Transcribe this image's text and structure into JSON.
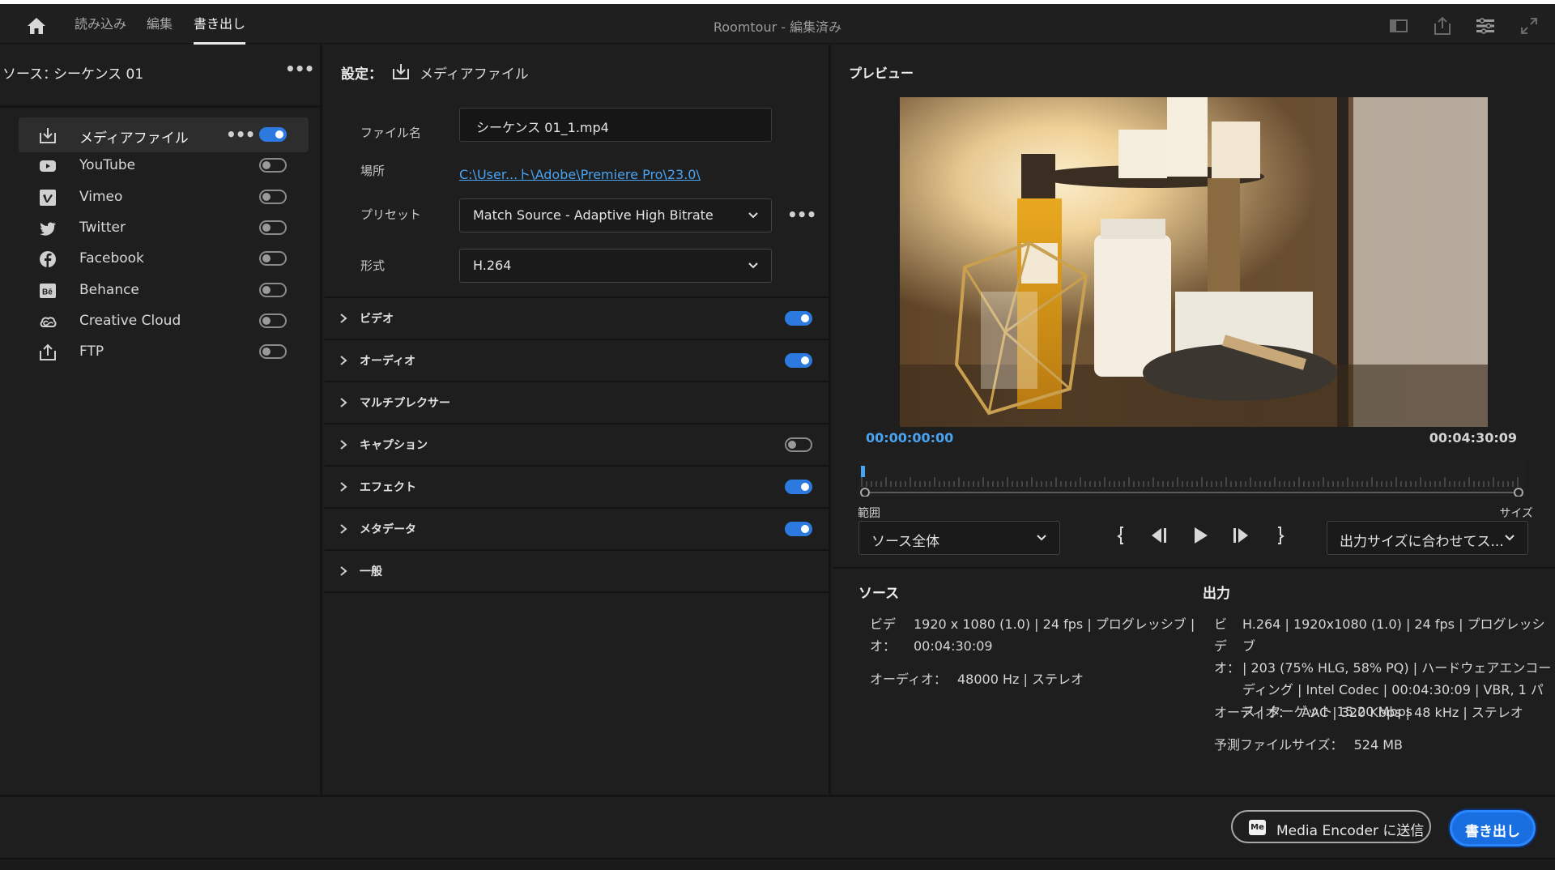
{
  "app": {
    "title": "Roomtour",
    "title_suffix": " - 編集済み"
  },
  "tabs": [
    {
      "label": "読み込み"
    },
    {
      "label": "編集"
    },
    {
      "label": "書き出し",
      "active": true
    }
  ],
  "source": {
    "label": "ソース：",
    "value": "シーケンス 01"
  },
  "destinations": [
    {
      "label": "メディアファイル",
      "icon": "media-file-export-icon",
      "enabled": true,
      "active": true
    },
    {
      "label": "YouTube",
      "icon": "youtube-icon",
      "enabled": false
    },
    {
      "label": "Vimeo",
      "icon": "vimeo-icon",
      "enabled": false
    },
    {
      "label": "Twitter",
      "icon": "twitter-icon",
      "enabled": false
    },
    {
      "label": "Facebook",
      "icon": "facebook-icon",
      "enabled": false
    },
    {
      "label": "Behance",
      "icon": "behance-icon",
      "enabled": false
    },
    {
      "label": "Creative Cloud",
      "icon": "creative-cloud-icon",
      "enabled": false
    },
    {
      "label": "FTP",
      "icon": "ftp-upload-icon",
      "enabled": false
    }
  ],
  "settings": {
    "label": "設定：",
    "target": "メディアファイル",
    "filename_label": "ファイル名",
    "filename": "シーケンス 01_1.mp4",
    "location_label": "場所",
    "location": "C:\\User...ト\\Adobe\\Premiere Pro\\23.0\\",
    "preset_label": "プリセット",
    "preset": "Match Source - Adaptive High Bitrate",
    "format_label": "形式",
    "format": "H.264",
    "sections": [
      {
        "name": "ビデオ",
        "toggle": true,
        "on": true
      },
      {
        "name": "オーディオ",
        "toggle": true,
        "on": true
      },
      {
        "name": "マルチプレクサー",
        "toggle": false
      },
      {
        "name": "キャプション",
        "toggle": true,
        "on": false
      },
      {
        "name": "エフェクト",
        "toggle": true,
        "on": true
      },
      {
        "name": "メタデータ",
        "toggle": true,
        "on": true
      },
      {
        "name": "一般",
        "toggle": false
      }
    ]
  },
  "preview": {
    "title": "プレビュー",
    "timecode_start": "00:00:00:00",
    "timecode_end": "00:04:30:09",
    "playhead_fraction": 0,
    "range_label": "範囲",
    "range_value": "ソース全体",
    "size_label": "サイズ",
    "size_value": "出力サイズに合わせてス..."
  },
  "info": {
    "source_title": "ソース",
    "source_video_key_1": "ビデ",
    "source_video_key_2": "オ：",
    "source_video_line_1": "1920 x 1080 (1.0) | 24 fps | プログレッシブ |",
    "source_video_line_2": "00:04:30:09",
    "source_audio_key": "オーディオ：",
    "source_audio": "48000 Hz | ステレオ",
    "output_title": "出力",
    "output_video_key_1": "ビ",
    "output_video_key_2": "デ",
    "output_video_key_3": "オ：",
    "output_video_line_1": "H.264 | 1920x1080 (1.0) | 24 fps | プログレッシブ",
    "output_video_line_2": "| 203 (75% HLG, 58% PQ) | ハードウェアエンコー",
    "output_video_line_3": "ディング | Intel Codec | 00:04:30:09 | VBR, 1 パ",
    "output_video_line_4": "ス | ターゲット 15.20 Mbps",
    "output_audio_key": "オーディオ：",
    "output_audio": "AAC | 320 Kbps | 48 kHz | ステレオ",
    "filesize_key": "予測ファイルサイズ：",
    "filesize": "524 MB"
  },
  "footer": {
    "media_encoder_badge": "Me",
    "media_encoder_label": "Media Encoder に送信",
    "export_label": "書き出し"
  },
  "colors": {
    "accent": "#1a6fe0",
    "timecode": "#4aa3f0",
    "link": "#4aa3f0"
  }
}
